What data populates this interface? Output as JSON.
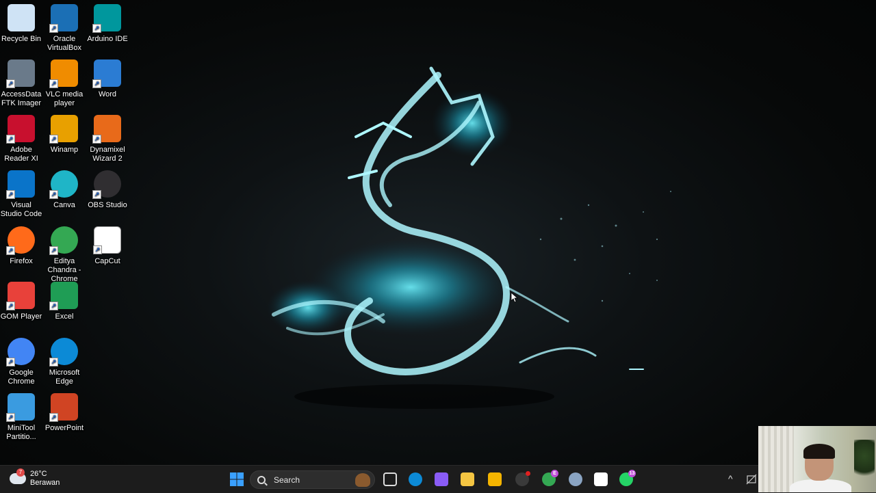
{
  "desktop": {
    "icons": [
      {
        "label": "Recycle Bin",
        "icon": "recycle-bin-icon",
        "color": "#cfe3f5"
      },
      {
        "label": "Oracle VirtualBox",
        "icon": "virtualbox-icon",
        "color": "#1b6fb5"
      },
      {
        "label": "Arduino IDE",
        "icon": "arduino-icon",
        "color": "#00979d"
      },
      {
        "label": "AccessData FTK Imager",
        "icon": "ftk-imager-icon",
        "color": "#6a7a8a"
      },
      {
        "label": "VLC media player",
        "icon": "vlc-icon",
        "color": "#f08c00"
      },
      {
        "label": "Word",
        "icon": "word-icon",
        "color": "#2b7cd3"
      },
      {
        "label": "Adobe Reader XI",
        "icon": "adobe-reader-icon",
        "color": "#c8102e"
      },
      {
        "label": "Winamp",
        "icon": "winamp-icon",
        "color": "#e8a000"
      },
      {
        "label": "Dynamixel Wizard 2",
        "icon": "dynamixel-icon",
        "color": "#e86a1a"
      },
      {
        "label": "Visual Studio Code",
        "icon": "vscode-icon",
        "color": "#0a74c9"
      },
      {
        "label": "Canva",
        "icon": "canva-icon",
        "color": "#1fb5c7"
      },
      {
        "label": "OBS Studio",
        "icon": "obs-icon",
        "color": "#302e31"
      },
      {
        "label": "Firefox",
        "icon": "firefox-icon",
        "color": "#ff6a1a"
      },
      {
        "label": "Editya Chandra - Chrome",
        "icon": "chrome-profile-icon",
        "color": "#34a853"
      },
      {
        "label": "CapCut",
        "icon": "capcut-icon",
        "color": "#ffffff"
      },
      {
        "label": "GOM Player",
        "icon": "gom-player-icon",
        "color": "#e8413a"
      },
      {
        "label": "Excel",
        "icon": "excel-icon",
        "color": "#1f9d55"
      },
      {
        "label": "Google Chrome",
        "icon": "chrome-icon",
        "color": "#4285f4"
      },
      {
        "label": "Microsoft Edge",
        "icon": "edge-icon",
        "color": "#0c8ad6"
      },
      {
        "label": "MiniTool Partitio...",
        "icon": "minitool-icon",
        "color": "#3a9be0"
      },
      {
        "label": "PowerPoint",
        "icon": "powerpoint-icon",
        "color": "#d04423"
      }
    ]
  },
  "taskbar": {
    "weather": {
      "temp": "26°C",
      "condition": "Berawan",
      "badge": "7"
    },
    "search_placeholder": "Search",
    "apps": [
      {
        "icon": "start-icon",
        "color": "#1a8cff"
      },
      {
        "icon": "task-view-icon",
        "color": "#dddddd"
      },
      {
        "icon": "edge-icon",
        "color": "#0c8ad6"
      },
      {
        "icon": "copilot-icon",
        "color": "#8a5cf6"
      },
      {
        "icon": "file-explorer-icon",
        "color": "#f4c542"
      },
      {
        "icon": "microsoft-store-icon",
        "color": "#f4b400"
      },
      {
        "icon": "obs-icon",
        "color": "#3a3a3a"
      },
      {
        "icon": "chrome-profile-icon",
        "color": "#34a853",
        "badge": "E"
      },
      {
        "icon": "settings-icon",
        "color": "#8aa4c2"
      },
      {
        "icon": "capcut-icon",
        "color": "#ffffff"
      },
      {
        "icon": "whatsapp-icon",
        "color": "#25d366",
        "badge": "13"
      }
    ],
    "tray": {
      "chevron": "^"
    }
  }
}
